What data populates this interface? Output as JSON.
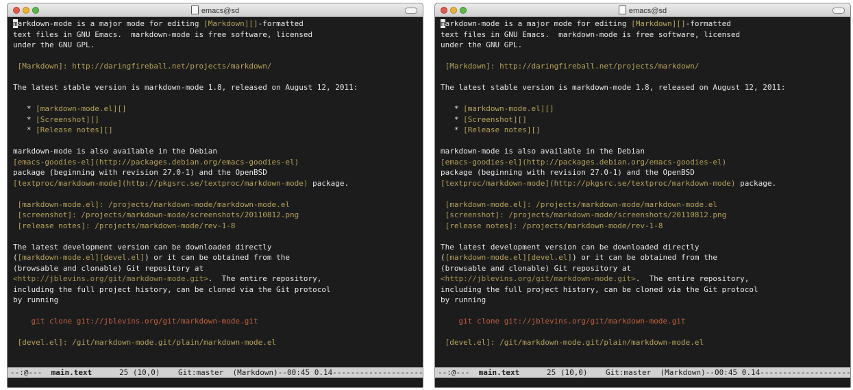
{
  "window_title": "emacs@sd",
  "lines": [
    [
      {
        "t": "m",
        "c": "cursor"
      },
      {
        "t": "arkdown-mode is a major mode for editing "
      },
      {
        "t": "[Markdown][]",
        "c": "lk"
      },
      {
        "t": "-formatted"
      }
    ],
    [
      {
        "t": "text files in GNU Emacs.  markdown-mode is free software, licensed"
      }
    ],
    [
      {
        "t": "under the GNU GPL."
      }
    ],
    [],
    [
      {
        "t": " [Markdown]: http://daringfireball.net/projects/markdown/",
        "c": "lk"
      }
    ],
    [],
    [
      {
        "t": "The latest stable version is markdown-mode 1.8, released on August 12, 2011:"
      }
    ],
    [],
    [
      {
        "t": "   * "
      },
      {
        "t": "[markdown-mode.el][]",
        "c": "lk"
      }
    ],
    [
      {
        "t": "   * "
      },
      {
        "t": "[Screenshot][]",
        "c": "lk"
      }
    ],
    [
      {
        "t": "   * "
      },
      {
        "t": "[Release notes][]",
        "c": "lk"
      }
    ],
    [],
    [
      {
        "t": "markdown-mode is also available in the Debian"
      }
    ],
    [
      {
        "t": "[emacs-goodies-el](http://packages.debian.org/emacs-goodies-el)",
        "c": "lk"
      }
    ],
    [
      {
        "t": "package (beginning with revision 27.0-1) and the OpenBSD"
      }
    ],
    [
      {
        "t": "[textproc/markdown-mode](http://pkgsrc.se/textproc/markdown-mode)",
        "c": "lk"
      },
      {
        "t": " package."
      }
    ],
    [],
    [
      {
        "t": " [markdown-mode.el]: /projects/markdown-mode/markdown-mode.el",
        "c": "lk"
      }
    ],
    [
      {
        "t": " [screenshot]: /projects/markdown-mode/screenshots/20110812.png",
        "c": "lk"
      }
    ],
    [
      {
        "t": " [release notes]: /projects/markdown-mode/rev-1-8",
        "c": "lk"
      }
    ],
    [],
    [
      {
        "t": "The latest development version can be downloaded directly"
      }
    ],
    [
      {
        "t": "("
      },
      {
        "t": "[markdown-mode.el][devel.el]",
        "c": "lk"
      },
      {
        "t": ") or it can be obtained from the"
      }
    ],
    [
      {
        "t": "(browsable and clonable) Git repository at"
      }
    ],
    [
      {
        "t": "<http://jblevins.org/git/markdown-mode.git>",
        "c": "url"
      },
      {
        "t": ".  The entire repository,"
      }
    ],
    [
      {
        "t": "including the full project history, can be cloned via the Git protocol"
      }
    ],
    [
      {
        "t": "by running"
      }
    ],
    [],
    [
      {
        "t": "    git clone git://jblevins.org/git/markdown-mode.git",
        "c": "git"
      }
    ],
    [],
    [
      {
        "t": " [devel.el]: /git/markdown-mode.git/plain/markdown-mode.el",
        "c": "lk"
      }
    ]
  ],
  "modeline": {
    "status": "--:@---  ",
    "buffer": "main.text",
    "rest": "      25 (10,0)    Git:master  (Markdown)--00:45 0.14--------------------"
  },
  "colors": {
    "background": "#1c1c1c",
    "text": "#e8e8e8",
    "link": "#b9a25a",
    "code": "#c0603a",
    "modeline": "#d2d2d2"
  }
}
